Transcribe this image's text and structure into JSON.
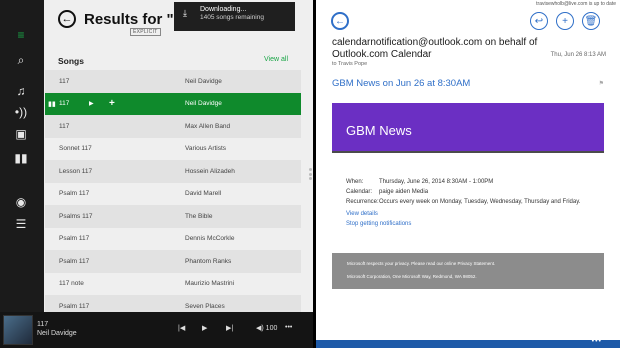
{
  "music": {
    "rail_icons": [
      "menu-icon",
      "search-icon",
      "music-note-icon",
      "radio-icon",
      "collection-icon",
      "chart-icon",
      "xbox-icon",
      "playlist-icon"
    ],
    "title": "Results for \"117\"",
    "explicit_badge": "EXPLICIT",
    "songs_label": "Songs",
    "view_all": "View all",
    "songs": [
      {
        "title": "117",
        "artist": "Neil Davidge"
      },
      {
        "title": "117",
        "artist": "Neil Davidge",
        "playing": true
      },
      {
        "title": "117",
        "artist": "Max Allen Band"
      },
      {
        "title": "Sonnet 117",
        "artist": "Various Artists"
      },
      {
        "title": "Lesson 117",
        "artist": "Hossein Alizadeh"
      },
      {
        "title": "Psalm 117",
        "artist": "David Marell"
      },
      {
        "title": "Psalms 117",
        "artist": "The Bible"
      },
      {
        "title": "Psalm 117",
        "artist": "Dennis McCorkle"
      },
      {
        "title": "Psalm 117",
        "artist": "Phantom Ranks"
      },
      {
        "title": "117 note",
        "artist": "Maurizio Mastrini"
      },
      {
        "title": "Psalm 117",
        "artist": "Seven Places"
      }
    ],
    "toast": {
      "title": "Downloading...",
      "subtitle": "1405 songs remaining"
    },
    "now_playing": {
      "title": "117",
      "artist": "Neil Davidge",
      "volume": "100"
    },
    "accent_color": "#0f8a2c"
  },
  "mail": {
    "status": "travisewholb@live.com is up to date",
    "from": "calendarnotification@outlook.com on behalf of Outlook.com Calendar",
    "to": "to Travis Pope",
    "date": "Thu, Jun 26  8:13 AM",
    "subject": "GBM News on Jun 26 at 8:30AM",
    "banner_title": "GBM News",
    "event": {
      "when_label": "When:",
      "when_value": "Thursday, June 26, 2014 8:30AM - 1:00PM",
      "calendar_label": "Calendar:",
      "calendar_value": "paige aiden Media",
      "recurrence_label": "Recurrence:",
      "recurrence_value": "Occurs every week on Monday, Tuesday, Wednesday, Thursday and Friday."
    },
    "view_details": "View details",
    "stop_notifications": "Stop getting notifications",
    "footer_line1": "Microsoft respects your privacy. Please read our online Privacy Statement.",
    "footer_line2": "Microsoft Corporation, One Microsoft Way, Redmond, WA 98052.",
    "banner_color": "#6b2fc3",
    "accent_color": "#2f6fc8"
  }
}
